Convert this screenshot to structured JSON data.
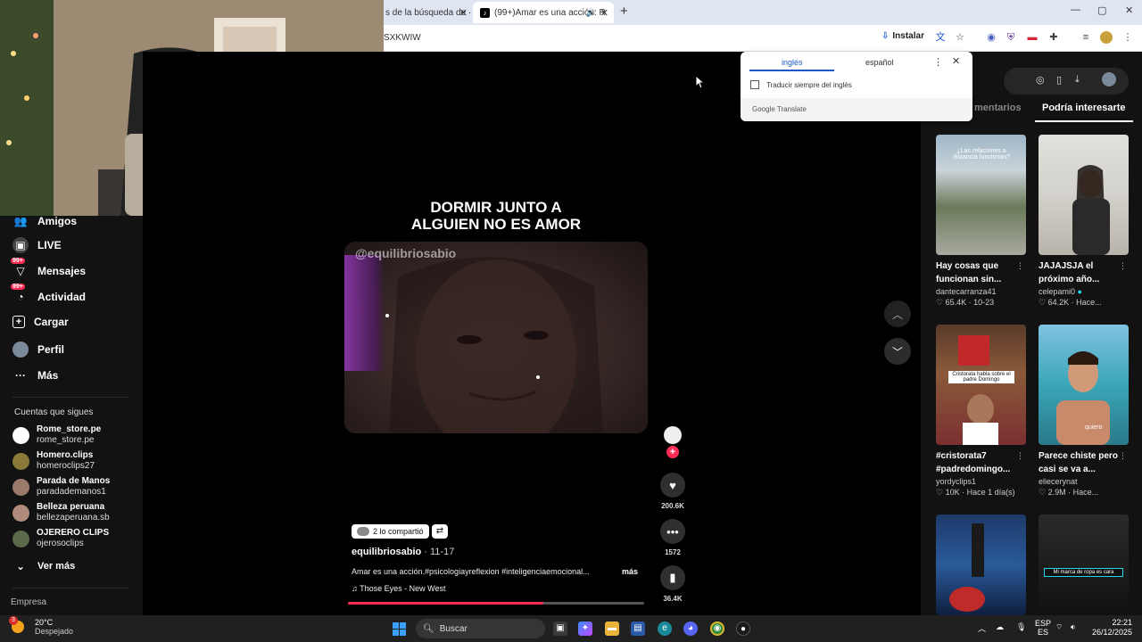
{
  "browser": {
    "tabs": [
      {
        "label": "s de la búsqueda de ·"
      },
      {
        "label": "(99+)Amar es una acción: R"
      }
    ],
    "new_tab": "+",
    "address_fragment": "SXKWIW",
    "install_label": "Instalar",
    "window_controls": {
      "minimize": "—",
      "maximize": "▢",
      "close": "✕"
    }
  },
  "translate_popup": {
    "tab_source": "inglés",
    "tab_target": "español",
    "checkbox_label": "Traducir siempre del inglés",
    "brand_google": "Google",
    "brand_translate": "Translate"
  },
  "sidebar": {
    "items": [
      {
        "label": "Amigos",
        "icon": "friends-icon",
        "badge": ""
      },
      {
        "label": "LIVE",
        "icon": "live-icon",
        "badge": ""
      },
      {
        "label": "Mensajes",
        "icon": "messages-icon",
        "badge": "99+"
      },
      {
        "label": "Actividad",
        "icon": "activity-icon",
        "badge": "99+"
      },
      {
        "label": "Cargar",
        "icon": "upload-icon",
        "badge": ""
      },
      {
        "label": "Perfil",
        "icon": "profile-icon",
        "badge": ""
      },
      {
        "label": "Más",
        "icon": "more-icon",
        "badge": ""
      }
    ],
    "following_title": "Cuentas que sigues",
    "following": [
      {
        "name": "Rome_store.pe",
        "handle": "rome_store.pe"
      },
      {
        "name": "Homero.clips",
        "handle": "homeroclips27"
      },
      {
        "name": "Parada de Manos",
        "handle": "paradademanos1"
      },
      {
        "name": "Belleza peruana",
        "handle": "bellezaperuana.sb"
      },
      {
        "name": "OJERERO CLIPS",
        "handle": "ojerosoclips"
      }
    ],
    "see_more": "Ver más",
    "company": "Empresa"
  },
  "video": {
    "overlay_title_line1": "DORMIR JUNTO A",
    "overlay_title_line2": "ALGUIEN NO ES AMOR",
    "watermark": "@equilibriosabio",
    "shared_label": "2 lo compartió",
    "author": "equilibriosabio",
    "date": " · 11-17",
    "caption": "Amar es una acción.#psicologiayreflexion #inteligenciaemocional...",
    "more_label": "más",
    "music": "Those Eyes - New West",
    "progress": 0.66,
    "likes": "200.6K",
    "comments": "1572",
    "saves": "36.4K"
  },
  "right_panel": {
    "tab_comments": "mentarios",
    "tab_suggested": "Podría interesarte",
    "cards": [
      {
        "title1": "Hay cosas que",
        "title2": "funcionan sin...",
        "user": "dantecarranza41",
        "likes": "65.4K",
        "when": "10-23",
        "thumb_text": "¿Las relaciones a distancia funcionan?"
      },
      {
        "title1": "JAJAJSJA el",
        "title2": "próximo año...",
        "user": "celepami0",
        "likes": "64.2K",
        "when": "Hace...",
        "thumb_text": ""
      },
      {
        "title1": "#cristorata7",
        "title2": "#padredomingo...",
        "user": "yordyclips1",
        "likes": "10K",
        "when": "Hace 1 día(s)",
        "thumb_text": "Cristorata habla sobre el padre Domingo"
      },
      {
        "title1": "Parece chiste pero",
        "title2": "casi se va a...",
        "user": "eliecerynat",
        "likes": "2.9M",
        "when": "Hace...",
        "thumb_text": "quiero"
      },
      {
        "title1": "",
        "title2": "",
        "user": "",
        "likes": "",
        "when": "",
        "thumb_text": ""
      },
      {
        "title1": "",
        "title2": "",
        "user": "",
        "likes": "",
        "when": "",
        "thumb_text": "Mi marca de ropa es cara"
      }
    ]
  },
  "taskbar": {
    "weather_temp": "20°C",
    "weather_desc": "Despejado",
    "weather_badge": "3",
    "search_label": "Buscar",
    "lang1": "ESP",
    "lang2": "ES",
    "time": "22:21",
    "date": "26/12/2025"
  },
  "colors": {
    "accent": "#fe2c55",
    "chrome_blue": "#1a57c8"
  }
}
